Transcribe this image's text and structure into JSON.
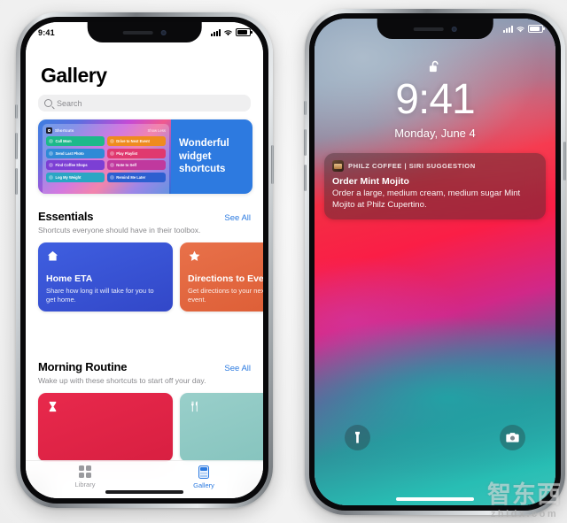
{
  "scene": {
    "watermark_cn": "智东西",
    "watermark_en": "zhidx.com"
  },
  "left_phone": {
    "status_bar": {
      "time": "9:41",
      "cellular_icon": "signal-bars-icon",
      "wifi_icon": "wifi-icon",
      "battery_icon": "battery-icon"
    },
    "app": {
      "title": "Gallery",
      "search": {
        "placeholder": "Search",
        "icon": "search-icon",
        "value": ""
      },
      "banner": {
        "widget_header_title": "Shortcuts",
        "widget_header_action": "Show Less",
        "headline": "Wonderful widget shortcuts",
        "widget_buttons": [
          {
            "label": "Call Mom",
            "color": "#1db98a"
          },
          {
            "label": "Drive to Next Event",
            "color": "#ef8b1f"
          },
          {
            "label": "Send Last Photo",
            "color": "#2f8ad6"
          },
          {
            "label": "Play Playlist",
            "color": "#e0396f"
          },
          {
            "label": "Find Coffee Shops",
            "color": "#7c3fd4"
          },
          {
            "label": "Note to Self",
            "color": "#c0399e"
          },
          {
            "label": "Log My Weight",
            "color": "#2aa6c4"
          },
          {
            "label": "Remind Me Later",
            "color": "#2d5fd0"
          }
        ]
      },
      "sections": [
        {
          "title": "Essentials",
          "see_all": "See All",
          "subtitle": "Shortcuts everyone should have in their toolbox.",
          "cards": [
            {
              "title": "Home ETA",
              "desc": "Share how long it will take for you to get home.",
              "icon": "home-icon",
              "color": "#3a56d8"
            },
            {
              "title": "Directions to Event",
              "desc": "Get directions to your next calendar event.",
              "icon": "star-icon",
              "color": "#e2663c"
            }
          ]
        },
        {
          "title": "Morning Routine",
          "see_all": "See All",
          "subtitle": "Wake up with these shortcuts to start off your day.",
          "cards": [
            {
              "title": "",
              "desc": "",
              "icon": "hourglass-icon",
              "color": "#e02747"
            },
            {
              "title": "",
              "desc": "",
              "icon": "fork-knife-icon",
              "color": "#8dc9c4"
            }
          ]
        }
      ],
      "tabs": [
        {
          "label": "Library",
          "icon": "library-grid-icon",
          "selected": false
        },
        {
          "label": "Gallery",
          "icon": "gallery-card-icon",
          "selected": true
        }
      ]
    }
  },
  "right_phone": {
    "status_bar": {
      "cellular_icon": "signal-bars-icon",
      "wifi_icon": "wifi-icon",
      "battery_icon": "battery-icon"
    },
    "lock_screen": {
      "lock_icon": "unlocked-padlock-icon",
      "time": "9:41",
      "date": "Monday, June 4",
      "notification": {
        "app_icon": "philz-coffee-icon",
        "source": "PHILZ COFFEE | SIRI SUGGESTION",
        "title": "Order Mint Mojito",
        "body": "Order a large, medium cream, medium sugar Mint Mojito at Philz Cupertino."
      },
      "flashlight_icon": "flashlight-icon",
      "camera_icon": "camera-icon"
    }
  },
  "accent_colors": {
    "ios_blue": "#2b7ae0",
    "notification_red": "#fa1e46",
    "wallpaper_teal": "#3cc3b9"
  }
}
